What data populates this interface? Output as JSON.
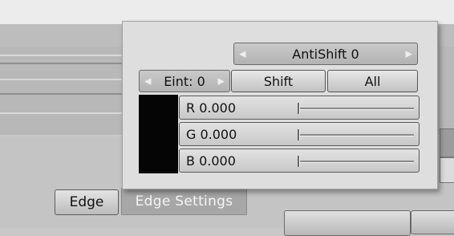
{
  "popup": {
    "antishift_label": "AntiShift 0",
    "eint_label": "Eint: 0",
    "shift_label": "Shift",
    "all_label": "All",
    "swatch_color": "#050505",
    "sliders": [
      {
        "label": "R 0.000",
        "value": 0.0
      },
      {
        "label": "G 0.000",
        "value": 0.0
      },
      {
        "label": "B 0.000",
        "value": 0.0
      }
    ]
  },
  "buttons": {
    "edge_label": "Edge",
    "edge_settings_label": "Edge Settings"
  }
}
